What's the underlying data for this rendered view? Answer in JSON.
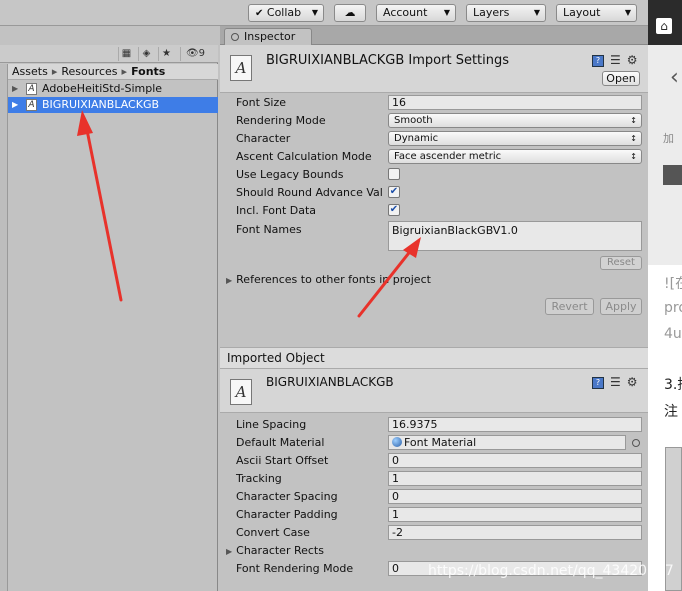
{
  "toolbar": {
    "collab_label": "Collab",
    "account_label": "Account",
    "layers_label": "Layers",
    "layout_label": "Layout"
  },
  "project": {
    "filter_count": "9",
    "breadcrumb": [
      "Assets",
      "Resources",
      "Fonts"
    ],
    "files": [
      {
        "name": "AdobeHeitiStd-Simple",
        "selected": false
      },
      {
        "name": "BIGRUIXIANBLACKGB",
        "selected": true
      }
    ]
  },
  "inspector": {
    "tab_label": "Inspector",
    "import_settings_title": "BIGRUIXIANBLACKGB Import Settings",
    "open_label": "Open",
    "props": {
      "font_size": {
        "label": "Font Size",
        "value": "16"
      },
      "rendering_mode": {
        "label": "Rendering Mode",
        "value": "Smooth"
      },
      "character": {
        "label": "Character",
        "value": "Dynamic"
      },
      "ascent": {
        "label": "Ascent Calculation Mode",
        "value": "Face ascender metric"
      },
      "legacy_bounds": {
        "label": "Use Legacy Bounds",
        "checked": false
      },
      "round_advance": {
        "label": "Should Round Advance Val",
        "checked": true
      },
      "incl_font_data": {
        "label": "Incl. Font Data",
        "checked": true
      },
      "font_names": {
        "label": "Font Names",
        "value": "BigruixianBlackGBV1.0"
      }
    },
    "reset_label": "Reset",
    "references_label": "References to other fonts in project",
    "revert_label": "Revert",
    "apply_label": "Apply",
    "imported_object_label": "Imported Object",
    "imported_title": "BIGRUIXIANBLACKGB",
    "imported_props": {
      "line_spacing": {
        "label": "Line Spacing",
        "value": "16.9375"
      },
      "default_material": {
        "label": "Default Material",
        "value": "Font Material"
      },
      "ascii_offset": {
        "label": "Ascii Start Offset",
        "value": "0"
      },
      "tracking": {
        "label": "Tracking",
        "value": "1"
      },
      "char_spacing": {
        "label": "Character Spacing",
        "value": "0"
      },
      "char_padding": {
        "label": "Character Padding",
        "value": "1"
      },
      "convert_case": {
        "label": "Convert Case",
        "value": "-2"
      },
      "char_rects": {
        "label": "Character Rects"
      },
      "rendering_mode": {
        "label": "Font Rendering Mode",
        "value": "0"
      }
    }
  },
  "right_strip": {
    "texts": [
      "加",
      "![在",
      "pro",
      "4u",
      "3.持",
      "注"
    ]
  },
  "watermark": "https://blog.csdn.net/qq_43420347",
  "colors": {
    "selection": "#3e7de7",
    "arrow": "#e8322b"
  }
}
